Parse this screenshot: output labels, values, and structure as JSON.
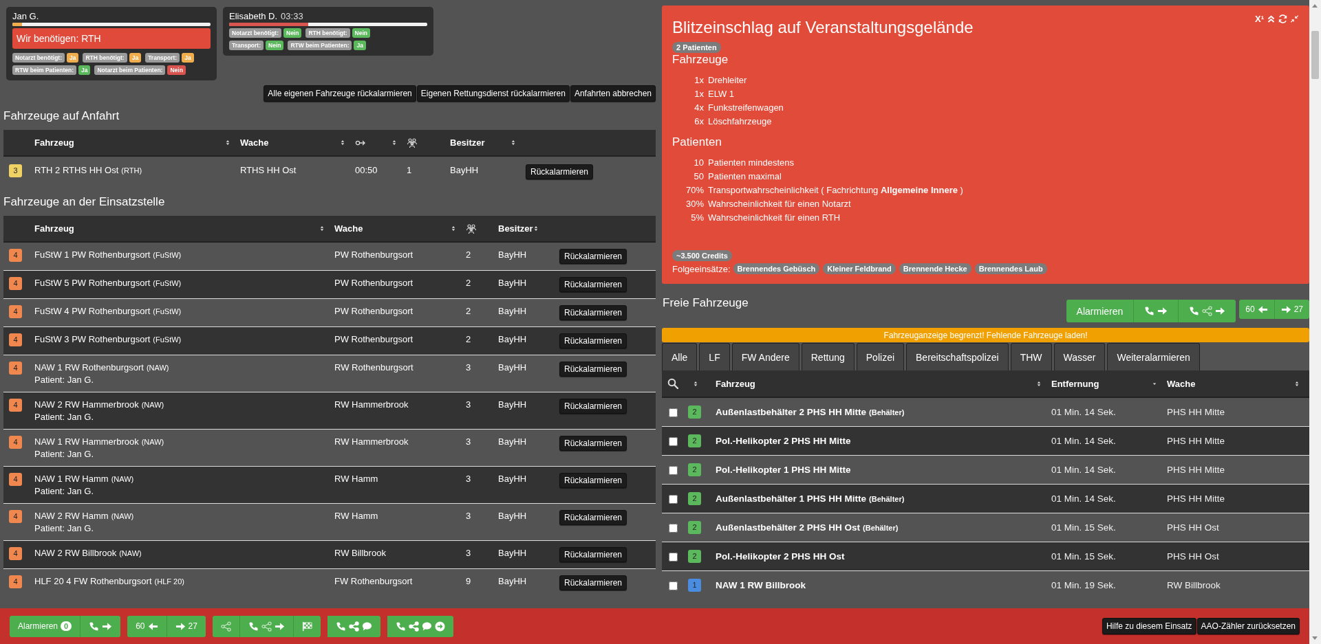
{
  "patients": [
    {
      "name": "Jan G.",
      "progress": {
        "level": 0.05,
        "color": "#f0ad4e"
      },
      "alert": "Wir benötigen: RTH",
      "flags": [
        {
          "label": "Notarzt benötigt:",
          "value": "Ja",
          "color": "#f0ad4e"
        },
        {
          "label": "RTH benötigt:",
          "value": "Ja",
          "color": "#f0ad4e"
        },
        {
          "label": "Transport:",
          "value": "Ja",
          "color": "#f0ad4e"
        },
        {
          "label": "RTW beim Patienten:",
          "value": "Ja",
          "color": "#5cb85c"
        },
        {
          "label": "Notarzt beim Patienten:",
          "value": "Nein",
          "color": "#d9534f"
        }
      ]
    },
    {
      "name": "Elisabeth D.",
      "time": "03:33",
      "progress": {
        "level": 0.4,
        "color": "#d9534f"
      },
      "flags": [
        {
          "label": "Notarzt benötigt:",
          "value": "Nein",
          "color": "#5cb85c"
        },
        {
          "label": "RTH benötigt:",
          "value": "Nein",
          "color": "#5cb85c"
        },
        {
          "label": "Transport:",
          "value": "Nein",
          "color": "#5cb85c"
        },
        {
          "label": "RTW beim Patienten:",
          "value": "Ja",
          "color": "#5cb85c"
        }
      ]
    }
  ],
  "actions": [
    "Alle eigenen Fahrzeuge rückalarmieren",
    "Eigenen Rettungsdienst rückalarmieren",
    "Anfahrten abbrechen"
  ],
  "en_route": {
    "title": "Fahrzeuge auf Anfahrt",
    "columns": [
      {
        "kind": "blank"
      },
      {
        "kind": "text",
        "label": "Fahrzeug",
        "sortable": true
      },
      {
        "kind": "text",
        "label": "Wache",
        "sortable": true
      },
      {
        "kind": "route",
        "sortable": true
      },
      {
        "kind": "crew",
        "sortable": false
      },
      {
        "kind": "text",
        "label": "Besitzer",
        "sortable": true
      },
      {
        "kind": "blank"
      }
    ],
    "rows": [
      {
        "status": "3",
        "color": "#f0d264",
        "vehicle": "RTH 2 RTHS HH Ost",
        "type": "(RTH)",
        "station": "RTHS HH Ost",
        "duration": "00:50",
        "crew": "1",
        "owner": "BayHH",
        "action": "Rückalarmieren"
      }
    ]
  },
  "on_scene": {
    "title": "Fahrzeuge an der Einsatzstelle",
    "columns": [
      {
        "kind": "blank"
      },
      {
        "kind": "text",
        "label": "Fahrzeug",
        "sortable": true
      },
      {
        "kind": "text",
        "label": "Wache",
        "sortable": true
      },
      {
        "kind": "crew",
        "sortable": false
      },
      {
        "kind": "text",
        "label": "Besitzer",
        "sortable": true
      },
      {
        "kind": "blank"
      }
    ],
    "rows": [
      {
        "status": "4",
        "color": "#f0874e",
        "vehicle": "FuStW 1 PW Rothenburgsort",
        "type": "(FuStW)",
        "station": "PW Rothenburgsort",
        "crew": "2",
        "owner": "BayHH",
        "action": "Rückalarmieren"
      },
      {
        "status": "4",
        "color": "#f0874e",
        "vehicle": "FuStW 5 PW Rothenburgsort",
        "type": "(FuStW)",
        "station": "PW Rothenburgsort",
        "crew": "2",
        "owner": "BayHH",
        "action": "Rückalarmieren"
      },
      {
        "status": "4",
        "color": "#f0874e",
        "vehicle": "FuStW 4 PW Rothenburgsort",
        "type": "(FuStW)",
        "station": "PW Rothenburgsort",
        "crew": "2",
        "owner": "BayHH",
        "action": "Rückalarmieren"
      },
      {
        "status": "4",
        "color": "#f0874e",
        "vehicle": "FuStW 3 PW Rothenburgsort",
        "type": "(FuStW)",
        "station": "PW Rothenburgsort",
        "crew": "2",
        "owner": "BayHH",
        "action": "Rückalarmieren"
      },
      {
        "status": "4",
        "color": "#f0874e",
        "vehicle": "NAW 1 RW Rothenburgsort",
        "type": "(NAW)",
        "patient": "Patient: Jan G.",
        "station": "RW Rothenburgsort",
        "crew": "3",
        "owner": "BayHH",
        "action": "Rückalarmieren"
      },
      {
        "status": "4",
        "color": "#f0874e",
        "vehicle": "NAW 2 RW Hammerbrook",
        "type": "(NAW)",
        "patient": "Patient: Jan G.",
        "station": "RW Hammerbrook",
        "crew": "3",
        "owner": "BayHH",
        "action": "Rückalarmieren"
      },
      {
        "status": "4",
        "color": "#f0874e",
        "vehicle": "NAW 1 RW Hammerbrook",
        "type": "(NAW)",
        "patient": "Patient: Jan G.",
        "station": "RW Hammerbrook",
        "crew": "3",
        "owner": "BayHH",
        "action": "Rückalarmieren"
      },
      {
        "status": "4",
        "color": "#f0874e",
        "vehicle": "NAW 1 RW Hamm",
        "type": "(NAW)",
        "patient": "Patient: Jan G.",
        "station": "RW Hamm",
        "crew": "3",
        "owner": "BayHH",
        "action": "Rückalarmieren"
      },
      {
        "status": "4",
        "color": "#f0874e",
        "vehicle": "NAW 2 RW Hamm",
        "type": "(NAW)",
        "patient": "Patient: Jan G.",
        "station": "RW Hamm",
        "crew": "3",
        "owner": "BayHH",
        "action": "Rückalarmieren"
      },
      {
        "status": "4",
        "color": "#f0874e",
        "vehicle": "NAW 2 RW Billbrook",
        "type": "(NAW)",
        "station": "RW Billbrook",
        "crew": "3",
        "owner": "BayHH",
        "action": "Rückalarmieren"
      },
      {
        "status": "4",
        "color": "#f0874e",
        "vehicle": "HLF 20 4 FW Rothenburgsort",
        "type": "(HLF 20)",
        "station": "FW Rothenburgsort",
        "crew": "9",
        "owner": "BayHH",
        "action": "Rückalarmieren"
      }
    ]
  },
  "mission": {
    "title": "Blitzeinschlag auf Veranstaltungsgelände",
    "toggle_label": "X¹",
    "patients_badge": "2 Patienten",
    "sections": [
      {
        "heading": "Fahrzeuge",
        "items": [
          {
            "count": "1x",
            "label": "Drehleiter"
          },
          {
            "count": "1x",
            "label": "ELW 1"
          },
          {
            "count": "4x",
            "label": "Funkstreifenwagen"
          },
          {
            "count": "6x",
            "label": "Löschfahrzeuge"
          }
        ]
      },
      {
        "heading": "Patienten",
        "items": [
          {
            "count": "10",
            "label": "Patienten mindestens"
          },
          {
            "count": "50",
            "label": "Patienten maximal"
          },
          {
            "count": "70%",
            "label": "Transportwahrscheinlichkeit ( Fachrichtung **Allgemeine Innere** )"
          },
          {
            "count": "30%",
            "label": "Wahrscheinlichkeit für einen Notarzt"
          },
          {
            "count": "5%",
            "label": "Wahrscheinlichkeit für einen RTH"
          }
        ]
      }
    ],
    "credits": "~3.500 Credits",
    "followups_label": "Folgeeinsätze:",
    "followups": [
      "Brennendes Gebüsch",
      "Kleiner Feldbrand",
      "Brennende Hecke",
      "Brennendes Laub"
    ]
  },
  "free": {
    "title": "Freie Fahrzeuge",
    "button_groups": [
      [
        {
          "kind": "alarm",
          "label": "Alarmieren"
        },
        {
          "kind": "alarm-next"
        },
        {
          "kind": "alarm-share-next"
        }
      ],
      [
        {
          "kind": "back",
          "label": "60"
        },
        {
          "kind": "forward",
          "label": "27"
        }
      ]
    ],
    "notice": "Fahrzeuganzeige begrenzt! Fehlende Fahrzeuge laden!",
    "tabs": [
      {
        "label": "Alle",
        "selected": false
      },
      {
        "label": "LF",
        "selected": false
      },
      {
        "label": "FW Andere",
        "selected": false
      },
      {
        "label": "Rettung",
        "selected": false
      },
      {
        "label": "Polizei",
        "selected": false
      },
      {
        "label": "Bereitschaftspolizei",
        "selected": false
      },
      {
        "label": "THW",
        "selected": false
      },
      {
        "label": "Wasser",
        "selected": false
      },
      {
        "label": "Weiteralarmieren",
        "selected": false
      }
    ],
    "columns": [
      {
        "kind": "search",
        "sortable": false
      },
      {
        "kind": "blank",
        "sortable": true,
        "descending": false
      },
      {
        "kind": "text",
        "label": "Fahrzeug",
        "sortable": true,
        "descending": false
      },
      {
        "kind": "text",
        "label": "Entfernung",
        "sortable": true,
        "descending": true
      },
      {
        "kind": "text",
        "label": "Wache",
        "sortable": true,
        "descending": false
      }
    ],
    "rows": [
      {
        "checked": false,
        "status": "2",
        "color": "#5cb85c",
        "vehicle": "Außenlastbehälter 2 PHS HH Mitte",
        "type": "(Behälter)",
        "distance": "01 Min. 14 Sek.",
        "station": "PHS HH Mitte"
      },
      {
        "checked": false,
        "status": "2",
        "color": "#5cb85c",
        "vehicle": "Pol.-Helikopter 2 PHS HH Mitte",
        "distance": "01 Min. 14 Sek.",
        "station": "PHS HH Mitte"
      },
      {
        "checked": false,
        "status": "2",
        "color": "#5cb85c",
        "vehicle": "Pol.-Helikopter 1 PHS HH Mitte",
        "distance": "01 Min. 14 Sek.",
        "station": "PHS HH Mitte"
      },
      {
        "checked": false,
        "status": "2",
        "color": "#5cb85c",
        "vehicle": "Außenlastbehälter 1 PHS HH Mitte",
        "type": "(Behälter)",
        "distance": "01 Min. 14 Sek.",
        "station": "PHS HH Mitte"
      },
      {
        "checked": false,
        "status": "2",
        "color": "#5cb85c",
        "vehicle": "Außenlastbehälter 2 PHS HH Ost",
        "type": "(Behälter)",
        "distance": "01 Min. 15 Sek.",
        "station": "PHS HH Ost"
      },
      {
        "checked": false,
        "status": "2",
        "color": "#5cb85c",
        "vehicle": "Pol.-Helikopter 2 PHS HH Ost",
        "distance": "01 Min. 15 Sek.",
        "station": "PHS HH Ost"
      },
      {
        "checked": false,
        "status": "1",
        "color": "#4a8de0",
        "vehicle": "NAW 1 RW Billbrook",
        "distance": "01 Min. 19 Sek.",
        "station": "RW Billbrook"
      }
    ]
  },
  "bottom_bar": {
    "button_groups": [
      [
        {
          "kind": "alarm",
          "label": "Alarmieren",
          "count": "0"
        },
        {
          "kind": "alarm-next"
        }
      ],
      [
        {
          "kind": "back",
          "label": "60"
        },
        {
          "kind": "forward",
          "label": "27"
        }
      ],
      [
        {
          "kind": "share"
        },
        {
          "kind": "alarm-share-next"
        },
        {
          "kind": "finish"
        }
      ],
      [
        {
          "kind": "alarm-share-chat"
        }
      ],
      [
        {
          "kind": "alarm-share-chat-next"
        }
      ]
    ],
    "links": [
      "Hilfe zu diesem Einsatz",
      "AAO-Zähler zurücksetzen"
    ]
  }
}
